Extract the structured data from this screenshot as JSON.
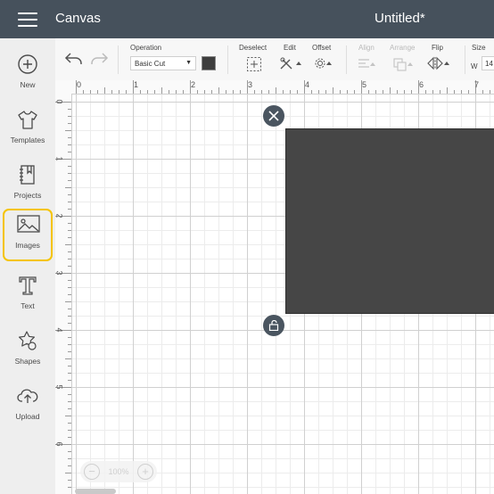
{
  "titlebar": {
    "app_title": "Canvas",
    "document_title": "Untitled*"
  },
  "sidebar": {
    "items": [
      {
        "label": "New",
        "icon": "plus-circle-icon"
      },
      {
        "label": "Templates",
        "icon": "tshirt-icon"
      },
      {
        "label": "Projects",
        "icon": "notebook-icon"
      },
      {
        "label": "Images",
        "icon": "image-icon",
        "active": true
      },
      {
        "label": "Text",
        "icon": "text-t-icon"
      },
      {
        "label": "Shapes",
        "icon": "shapes-icon"
      },
      {
        "label": "Upload",
        "icon": "cloud-upload-icon"
      }
    ],
    "active_color": "#f5c400"
  },
  "toolbar": {
    "operation_label": "Operation",
    "operation_value": "Basic Cut",
    "deselect_label": "Deselect",
    "edit_label": "Edit",
    "offset_label": "Offset",
    "align_label": "Align",
    "arrange_label": "Arrange",
    "flip_label": "Flip",
    "size_label": "Size",
    "size_w_label": "W",
    "size_w_value": "14",
    "swatch_color": "#3d3d3d"
  },
  "rulers": {
    "top": [
      "0",
      "1",
      "2",
      "3",
      "4",
      "5",
      "6",
      "7"
    ],
    "left": [
      "0",
      "1",
      "2",
      "3",
      "4",
      "5",
      "6"
    ]
  },
  "zoom": {
    "value": "100%",
    "minus": "−",
    "plus": "+"
  },
  "colors": {
    "titlebar": "#46515c",
    "shape_fill": "#464646",
    "handle": "#4a5560"
  }
}
